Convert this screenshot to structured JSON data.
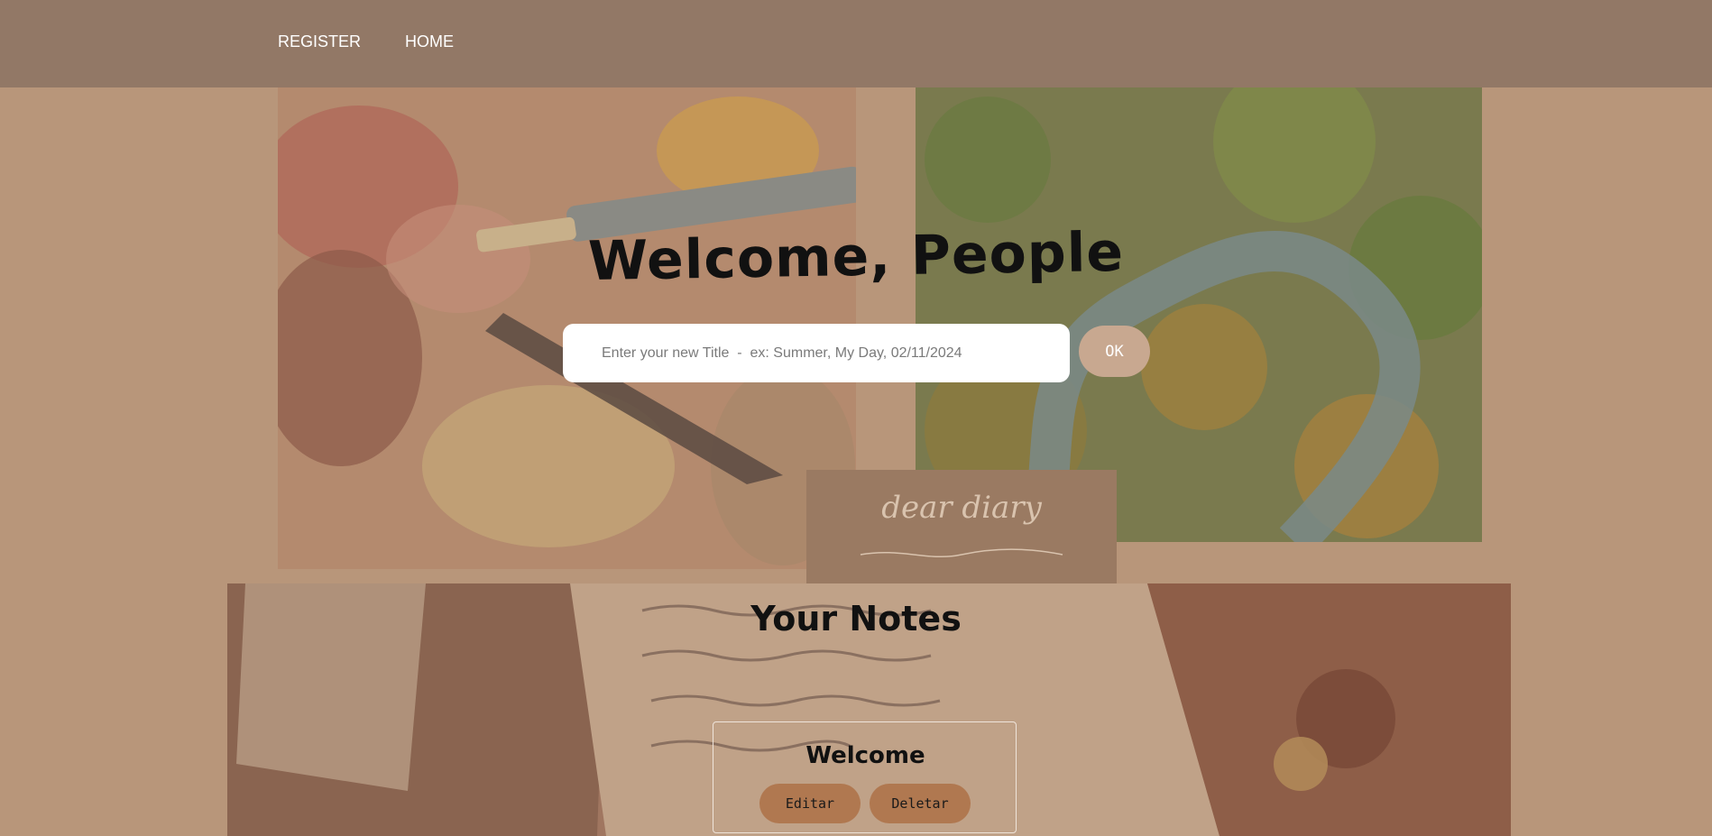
{
  "nav": {
    "register_label": "REGISTER",
    "home_label": "HOME"
  },
  "hero": {
    "title": "Welcome, People",
    "input_placeholder": "Enter your new Title  -  ex: Summer, My Day, 02/11/2024",
    "ok_label": "OK"
  },
  "badge": {
    "text": "dear diary"
  },
  "notes": {
    "section_title": "Your Notes",
    "items": [
      {
        "title": "Welcome",
        "edit_label": "Editar",
        "delete_label": "Deletar"
      }
    ]
  },
  "colors": {
    "page_background": "#b8967a",
    "nav_background": "#927866",
    "ok_button": "#c8a890",
    "note_button": "#b07850",
    "badge_background": "#9a7a62"
  }
}
